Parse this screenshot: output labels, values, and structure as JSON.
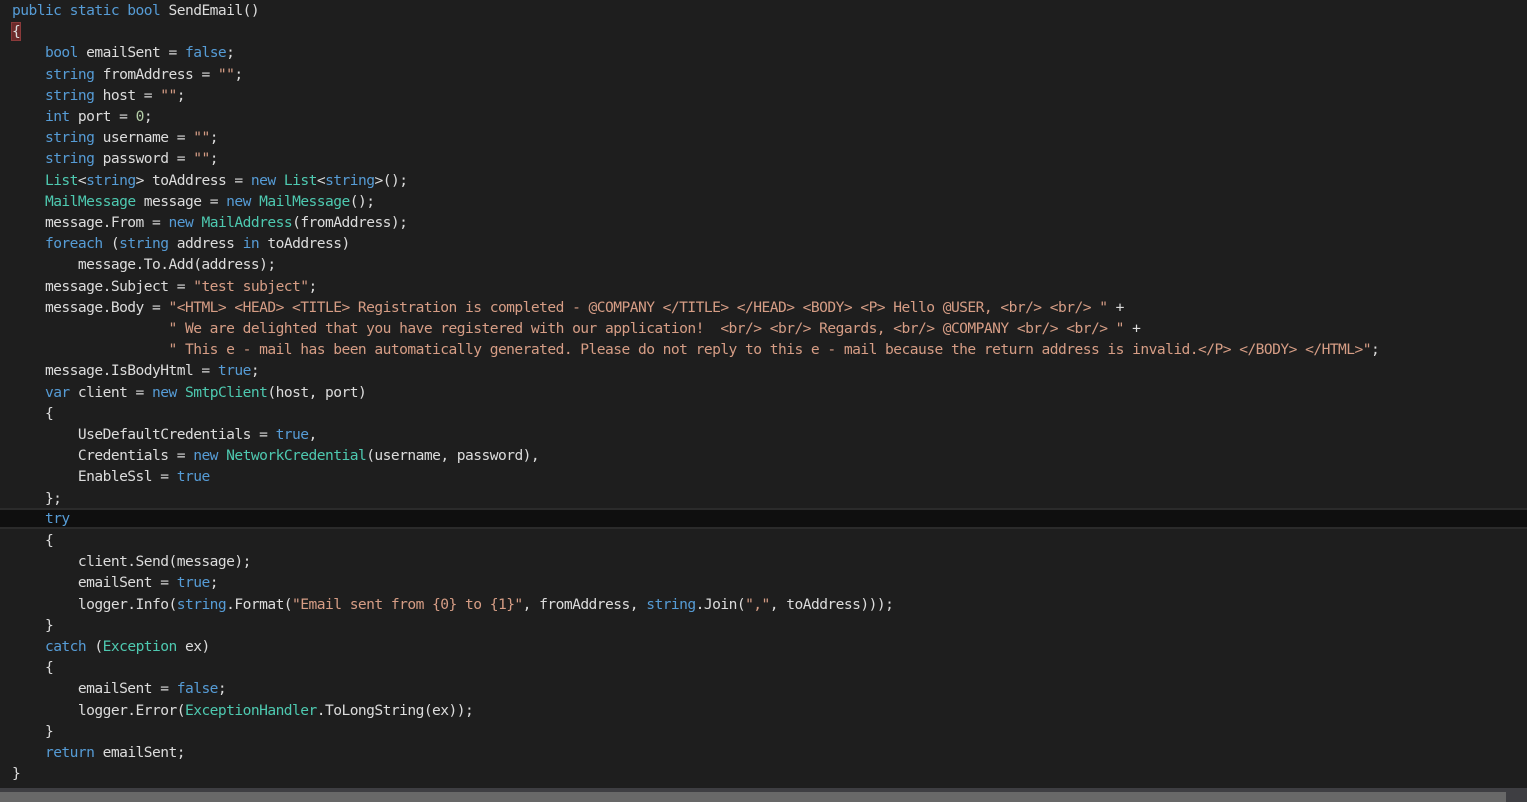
{
  "editor": {
    "language": "C#",
    "theme_colors": {
      "background": "#1e1e1e",
      "keyword": "#569cd6",
      "type": "#4ec9b0",
      "string": "#d69d85",
      "number": "#b5cea8",
      "plain": "#dcdcdc",
      "current_line": "#0f0f0f",
      "brace_match": "#6b2a2a"
    },
    "current_line_index": 24,
    "lines": [
      [
        [
          "kw",
          "public static bool "
        ],
        [
          "pl",
          "SendEmail()"
        ]
      ],
      [
        [
          "brace",
          "{"
        ]
      ],
      [
        [
          "pl",
          "    "
        ],
        [
          "kw",
          "bool"
        ],
        [
          "pl",
          " emailSent = "
        ],
        [
          "kw",
          "false"
        ],
        [
          "pl",
          ";"
        ]
      ],
      [
        [
          "pl",
          "    "
        ],
        [
          "kw",
          "string"
        ],
        [
          "pl",
          " fromAddress = "
        ],
        [
          "str",
          "\"\""
        ],
        [
          "pl",
          ";"
        ]
      ],
      [
        [
          "pl",
          "    "
        ],
        [
          "kw",
          "string"
        ],
        [
          "pl",
          " host = "
        ],
        [
          "str",
          "\"\""
        ],
        [
          "pl",
          ";"
        ]
      ],
      [
        [
          "pl",
          "    "
        ],
        [
          "kw",
          "int"
        ],
        [
          "pl",
          " port = "
        ],
        [
          "num",
          "0"
        ],
        [
          "pl",
          ";"
        ]
      ],
      [
        [
          "pl",
          "    "
        ],
        [
          "kw",
          "string"
        ],
        [
          "pl",
          " username = "
        ],
        [
          "str",
          "\"\""
        ],
        [
          "pl",
          ";"
        ]
      ],
      [
        [
          "pl",
          "    "
        ],
        [
          "kw",
          "string"
        ],
        [
          "pl",
          " password = "
        ],
        [
          "str",
          "\"\""
        ],
        [
          "pl",
          ";"
        ]
      ],
      [
        [
          "pl",
          "    "
        ],
        [
          "ty",
          "List"
        ],
        [
          "pl",
          "<"
        ],
        [
          "kw",
          "string"
        ],
        [
          "pl",
          "> toAddress = "
        ],
        [
          "kw",
          "new"
        ],
        [
          "pl",
          " "
        ],
        [
          "ty",
          "List"
        ],
        [
          "pl",
          "<"
        ],
        [
          "kw",
          "string"
        ],
        [
          "pl",
          ">();"
        ]
      ],
      [
        [
          "pl",
          "    "
        ],
        [
          "ty",
          "MailMessage"
        ],
        [
          "pl",
          " message = "
        ],
        [
          "kw",
          "new"
        ],
        [
          "pl",
          " "
        ],
        [
          "ty",
          "MailMessage"
        ],
        [
          "pl",
          "();"
        ]
      ],
      [
        [
          "pl",
          "    message.From = "
        ],
        [
          "kw",
          "new"
        ],
        [
          "pl",
          " "
        ],
        [
          "ty",
          "MailAddress"
        ],
        [
          "pl",
          "(fromAddress);"
        ]
      ],
      [
        [
          "pl",
          "    "
        ],
        [
          "kw",
          "foreach"
        ],
        [
          "pl",
          " ("
        ],
        [
          "kw",
          "string"
        ],
        [
          "pl",
          " address "
        ],
        [
          "kw",
          "in"
        ],
        [
          "pl",
          " toAddress)"
        ]
      ],
      [
        [
          "pl",
          "        message.To.Add(address);"
        ]
      ],
      [
        [
          "pl",
          "    message.Subject = "
        ],
        [
          "str",
          "\"test subject\""
        ],
        [
          "pl",
          ";"
        ]
      ],
      [
        [
          "pl",
          "    message.Body = "
        ],
        [
          "str",
          "\"<HTML> <HEAD> <TITLE> Registration is completed - @COMPANY </TITLE> </HEAD> <BODY> <P> Hello @USER, <br/> <br/> \""
        ],
        [
          "pl",
          " +"
        ]
      ],
      [
        [
          "pl",
          "                   "
        ],
        [
          "str",
          "\" We are delighted that you have registered with our application!  <br/> <br/> Regards, <br/> @COMPANY <br/> <br/> \""
        ],
        [
          "pl",
          " +"
        ]
      ],
      [
        [
          "pl",
          "                   "
        ],
        [
          "str",
          "\" This e - mail has been automatically generated. Please do not reply to this e - mail because the return address is invalid.</P> </BODY> </HTML>\""
        ],
        [
          "pl",
          ";"
        ]
      ],
      [
        [
          "pl",
          "    message.IsBodyHtml = "
        ],
        [
          "kw",
          "true"
        ],
        [
          "pl",
          ";"
        ]
      ],
      [
        [
          "pl",
          "    "
        ],
        [
          "kw",
          "var"
        ],
        [
          "pl",
          " client = "
        ],
        [
          "kw",
          "new"
        ],
        [
          "pl",
          " "
        ],
        [
          "ty",
          "SmtpClient"
        ],
        [
          "pl",
          "(host, port)"
        ]
      ],
      [
        [
          "pl",
          "    {"
        ]
      ],
      [
        [
          "pl",
          "        UseDefaultCredentials = "
        ],
        [
          "kw",
          "true"
        ],
        [
          "pl",
          ","
        ]
      ],
      [
        [
          "pl",
          "        Credentials = "
        ],
        [
          "kw",
          "new"
        ],
        [
          "pl",
          " "
        ],
        [
          "ty",
          "NetworkCredential"
        ],
        [
          "pl",
          "(username, password),"
        ]
      ],
      [
        [
          "pl",
          "        EnableSsl = "
        ],
        [
          "kw",
          "true"
        ]
      ],
      [
        [
          "pl",
          "    };"
        ]
      ],
      [
        [
          "pl",
          "    "
        ],
        [
          "kw",
          "try"
        ]
      ],
      [
        [
          "pl",
          "    {"
        ]
      ],
      [
        [
          "pl",
          "        client.Send(message);"
        ]
      ],
      [
        [
          "pl",
          "        emailSent = "
        ],
        [
          "kw",
          "true"
        ],
        [
          "pl",
          ";"
        ]
      ],
      [
        [
          "pl",
          "        logger.Info("
        ],
        [
          "kw",
          "string"
        ],
        [
          "pl",
          ".Format("
        ],
        [
          "str",
          "\"Email sent from {0} to {1}\""
        ],
        [
          "pl",
          ", fromAddress, "
        ],
        [
          "kw",
          "string"
        ],
        [
          "pl",
          ".Join("
        ],
        [
          "str",
          "\",\""
        ],
        [
          "pl",
          ", toAddress)));"
        ]
      ],
      [
        [
          "pl",
          "    }"
        ]
      ],
      [
        [
          "pl",
          "    "
        ],
        [
          "kw",
          "catch"
        ],
        [
          "pl",
          " ("
        ],
        [
          "ty",
          "Exception"
        ],
        [
          "pl",
          " ex)"
        ]
      ],
      [
        [
          "pl",
          "    {"
        ]
      ],
      [
        [
          "pl",
          "        emailSent = "
        ],
        [
          "kw",
          "false"
        ],
        [
          "pl",
          ";"
        ]
      ],
      [
        [
          "pl",
          "        logger.Error("
        ],
        [
          "ty",
          "ExceptionHandler"
        ],
        [
          "pl",
          ".ToLongString(ex));"
        ]
      ],
      [
        [
          "pl",
          "    }"
        ]
      ],
      [
        [
          "pl",
          "    "
        ],
        [
          "kw",
          "return"
        ],
        [
          "pl",
          " emailSent;"
        ]
      ],
      [
        [
          "pl",
          "}"
        ]
      ]
    ]
  },
  "scrollbar": {
    "horizontal_thumb_fraction": 0.986,
    "horizontal_position_fraction": 0.0
  }
}
